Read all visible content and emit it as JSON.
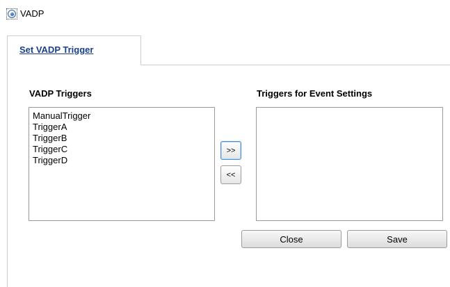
{
  "mode": {
    "label": "VADP",
    "selected": true
  },
  "tabs": [
    {
      "label": "Set VADP Trigger",
      "active": true
    }
  ],
  "left_list": {
    "heading": "VADP Triggers",
    "items": [
      "ManualTrigger",
      "TriggerA",
      "TriggerB",
      "TriggerC",
      "TriggerD"
    ]
  },
  "right_list": {
    "heading": "Triggers for Event Settings",
    "items": []
  },
  "move_buttons": {
    "add_label": ">>",
    "remove_label": "<<"
  },
  "actions": {
    "close_label": "Close",
    "save_label": "Save"
  },
  "colors": {
    "tab_link": "#1a3f8c",
    "focus_border": "#4a8bd6",
    "border": "#9a9a9a"
  }
}
